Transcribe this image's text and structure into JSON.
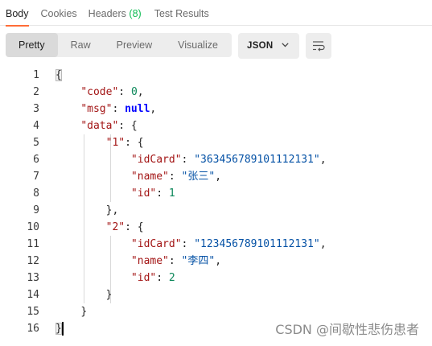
{
  "tabs": [
    {
      "label": "Body",
      "active": true
    },
    {
      "label": "Cookies"
    },
    {
      "label": "Headers",
      "count": "(8)"
    },
    {
      "label": "Test Results"
    }
  ],
  "view_modes": [
    "Pretty",
    "Raw",
    "Preview",
    "Visualize"
  ],
  "active_view": "Pretty",
  "format": {
    "selected": "JSON",
    "icon": "chevron-down-icon"
  },
  "wrap_button_icon": "wrap-lines-icon",
  "line_numbers": [
    "1",
    "2",
    "3",
    "4",
    "5",
    "6",
    "7",
    "8",
    "9",
    "10",
    "11",
    "12",
    "13",
    "14",
    "15",
    "16"
  ],
  "json_body": {
    "code_key": "\"code\"",
    "code_val": "0",
    "msg_key": "\"msg\"",
    "msg_val": "null",
    "data_key": "\"data\"",
    "items": [
      {
        "key": "\"1\"",
        "idCard_key": "\"idCard\"",
        "idCard_val": "\"363456789101112131\"",
        "name_key": "\"name\"",
        "name_val": "\"张三\"",
        "id_key": "\"id\"",
        "id_val": "1"
      },
      {
        "key": "\"2\"",
        "idCard_key": "\"idCard\"",
        "idCard_val": "\"123456789101112131\"",
        "name_key": "\"name\"",
        "name_val": "\"李四\"",
        "id_key": "\"id\"",
        "id_val": "2"
      }
    ]
  },
  "colors": {
    "accent": "#ff6c37",
    "count": "#0cbb52",
    "key": "#a31515",
    "string": "#0451a5",
    "number": "#098658",
    "keyword": "#0000ff"
  },
  "watermark": "CSDN @间歇性悲伤患者"
}
